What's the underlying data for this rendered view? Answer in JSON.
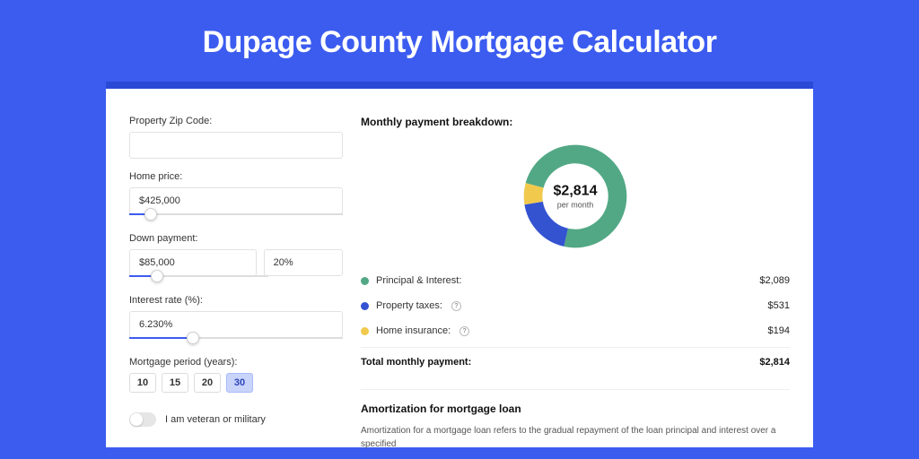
{
  "title": "Dupage County Mortgage Calculator",
  "form": {
    "zip": {
      "label": "Property Zip Code:",
      "value": ""
    },
    "price": {
      "label": "Home price:",
      "value": "$425,000",
      "slider_pct": 10
    },
    "down": {
      "label": "Down payment:",
      "amount": "$85,000",
      "pct": "20%",
      "slider_pct": 20
    },
    "rate": {
      "label": "Interest rate (%):",
      "value": "6.230%",
      "slider_pct": 30
    },
    "period": {
      "label": "Mortgage period (years):",
      "options": [
        "10",
        "15",
        "20",
        "30"
      ],
      "active_index": 3
    },
    "veteran": {
      "label": "I am veteran or military",
      "checked": false
    }
  },
  "breakdown": {
    "title": "Monthly payment breakdown:",
    "center_amount": "$2,814",
    "center_label": "per month",
    "items": [
      {
        "label": "Principal & Interest:",
        "value": "$2,089",
        "color": "#52a885",
        "info": false
      },
      {
        "label": "Property taxes:",
        "value": "$531",
        "color": "#3453d1",
        "info": true
      },
      {
        "label": "Home insurance:",
        "value": "$194",
        "color": "#f1c94d",
        "info": true
      }
    ],
    "total": {
      "label": "Total monthly payment:",
      "value": "$2,814"
    }
  },
  "amort": {
    "title": "Amortization for mortgage loan",
    "text": "Amortization for a mortgage loan refers to the gradual repayment of the loan principal and interest over a specified"
  },
  "chart_data": {
    "type": "pie",
    "title": "Monthly payment breakdown",
    "series": [
      {
        "name": "Principal & Interest",
        "value": 2089,
        "color": "#52a885"
      },
      {
        "name": "Property taxes",
        "value": 531,
        "color": "#3453d1"
      },
      {
        "name": "Home insurance",
        "value": 194,
        "color": "#f1c94d"
      }
    ],
    "total": 2814,
    "ylabel": "",
    "xlabel": ""
  }
}
